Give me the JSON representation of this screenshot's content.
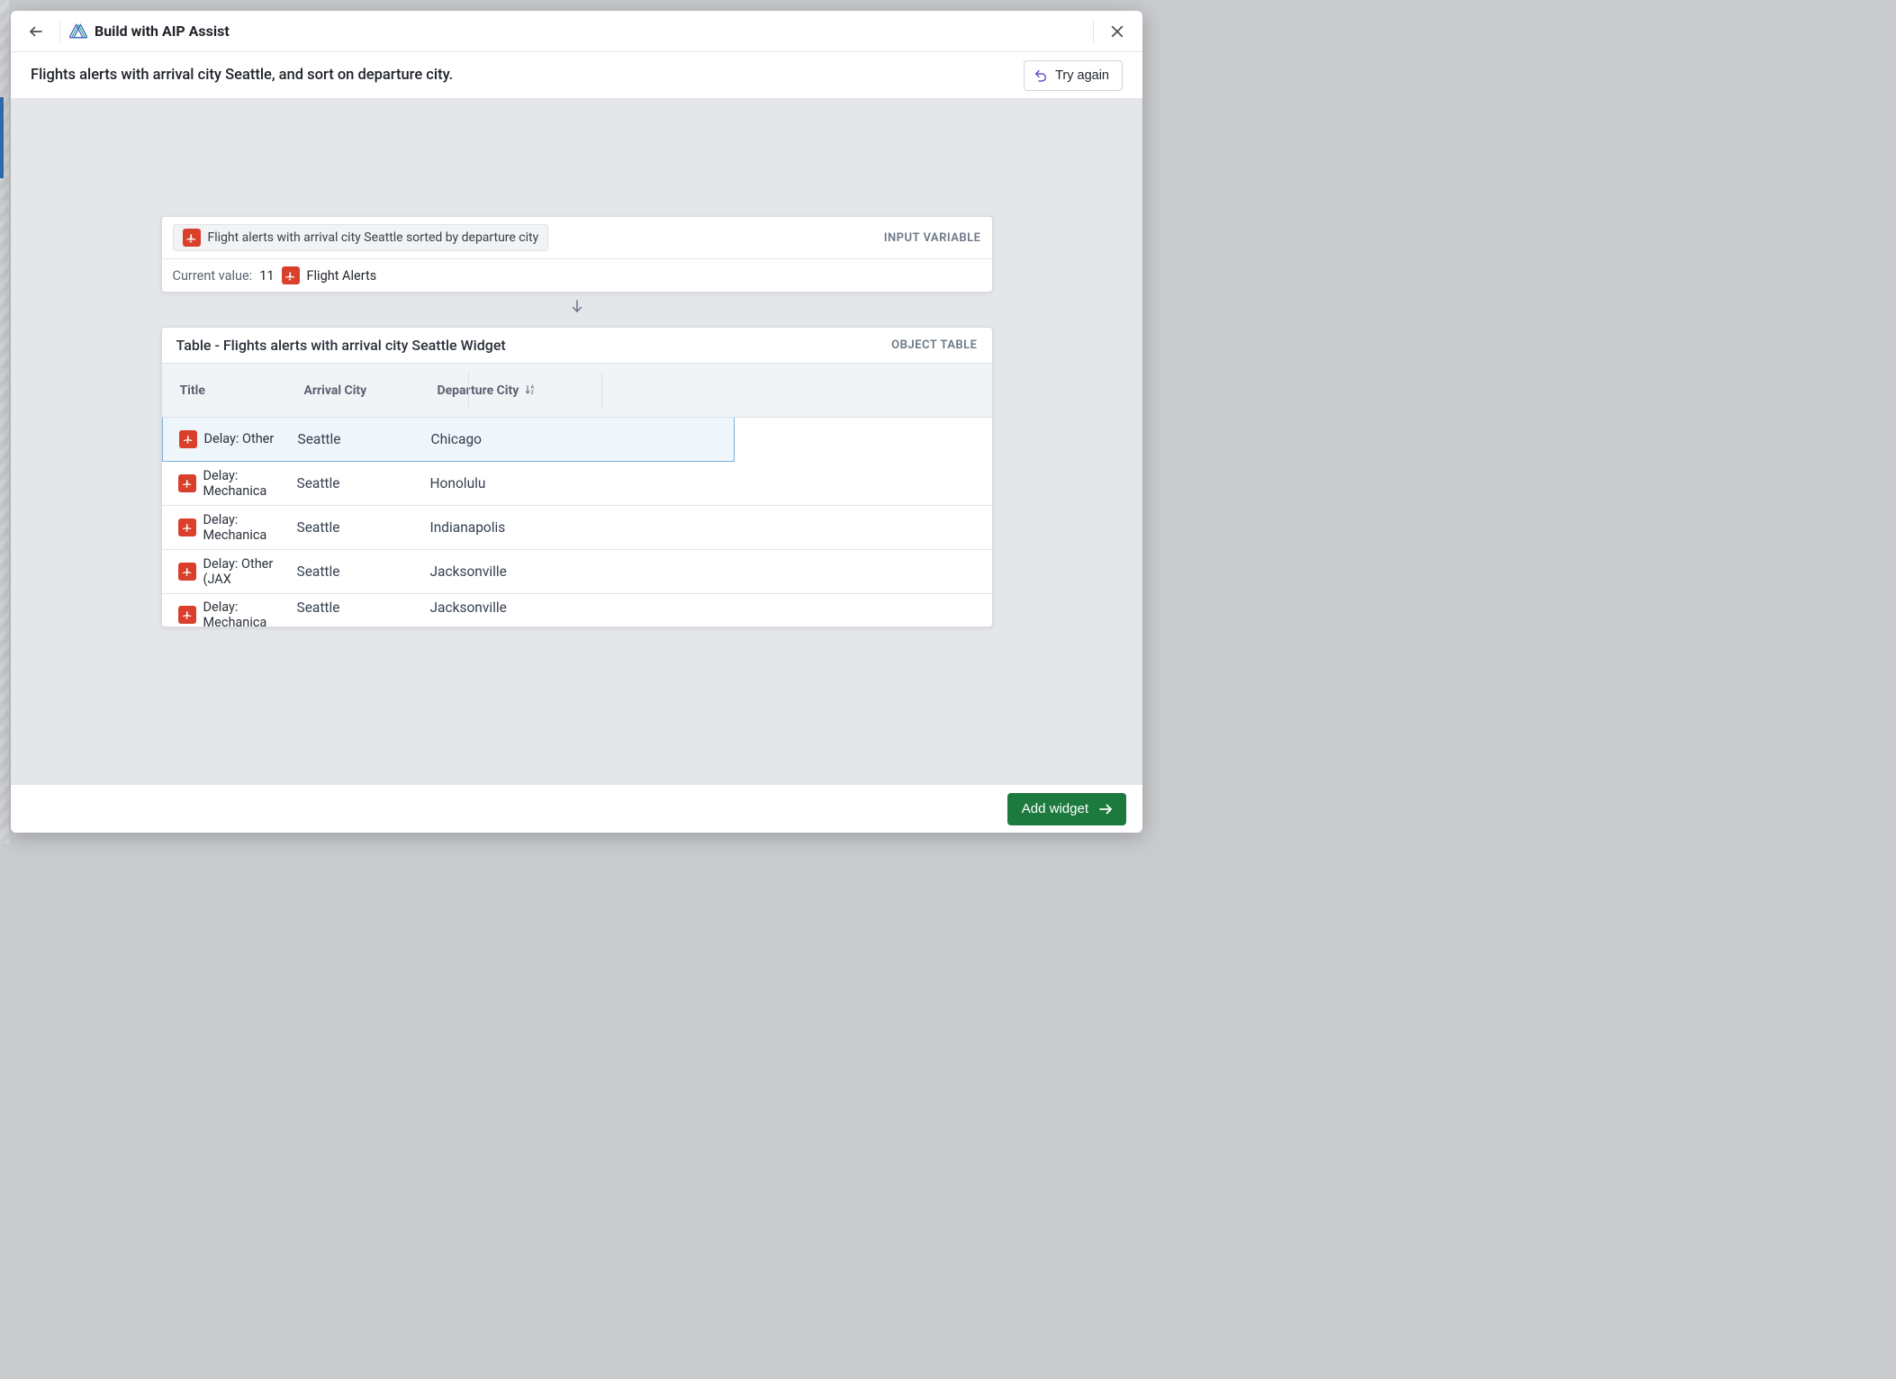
{
  "header": {
    "title": "Build with AIP Assist"
  },
  "prompt": {
    "text": "Flights alerts with arrival city Seattle, and sort on departure city.",
    "try_again_label": "Try again"
  },
  "input_variable_card": {
    "chip_text": "Flight alerts with arrival city Seattle sorted by departure city",
    "badge": "INPUT VARIABLE",
    "current_value_label": "Current value:",
    "count": "11",
    "object_name": "Flight Alerts"
  },
  "table_card": {
    "title": "Table - Flights alerts with arrival city Seattle Widget",
    "badge": "OBJECT TABLE",
    "columns": {
      "title": "Title",
      "arrival_city": "Arrival City",
      "departure_city": "Departure City"
    },
    "rows": [
      {
        "title": "Delay: Other",
        "arrival": "Seattle",
        "departure": "Chicago"
      },
      {
        "title": "Delay: Mechanica",
        "arrival": "Seattle",
        "departure": "Honolulu"
      },
      {
        "title": "Delay: Mechanica",
        "arrival": "Seattle",
        "departure": "Indianapolis"
      },
      {
        "title": "Delay: Other (JAX",
        "arrival": "Seattle",
        "departure": "Jacksonville"
      },
      {
        "title": "Delay: Mechanica",
        "arrival": "Seattle",
        "departure": "Jacksonville"
      }
    ]
  },
  "footer": {
    "add_widget_label": "Add widget"
  }
}
